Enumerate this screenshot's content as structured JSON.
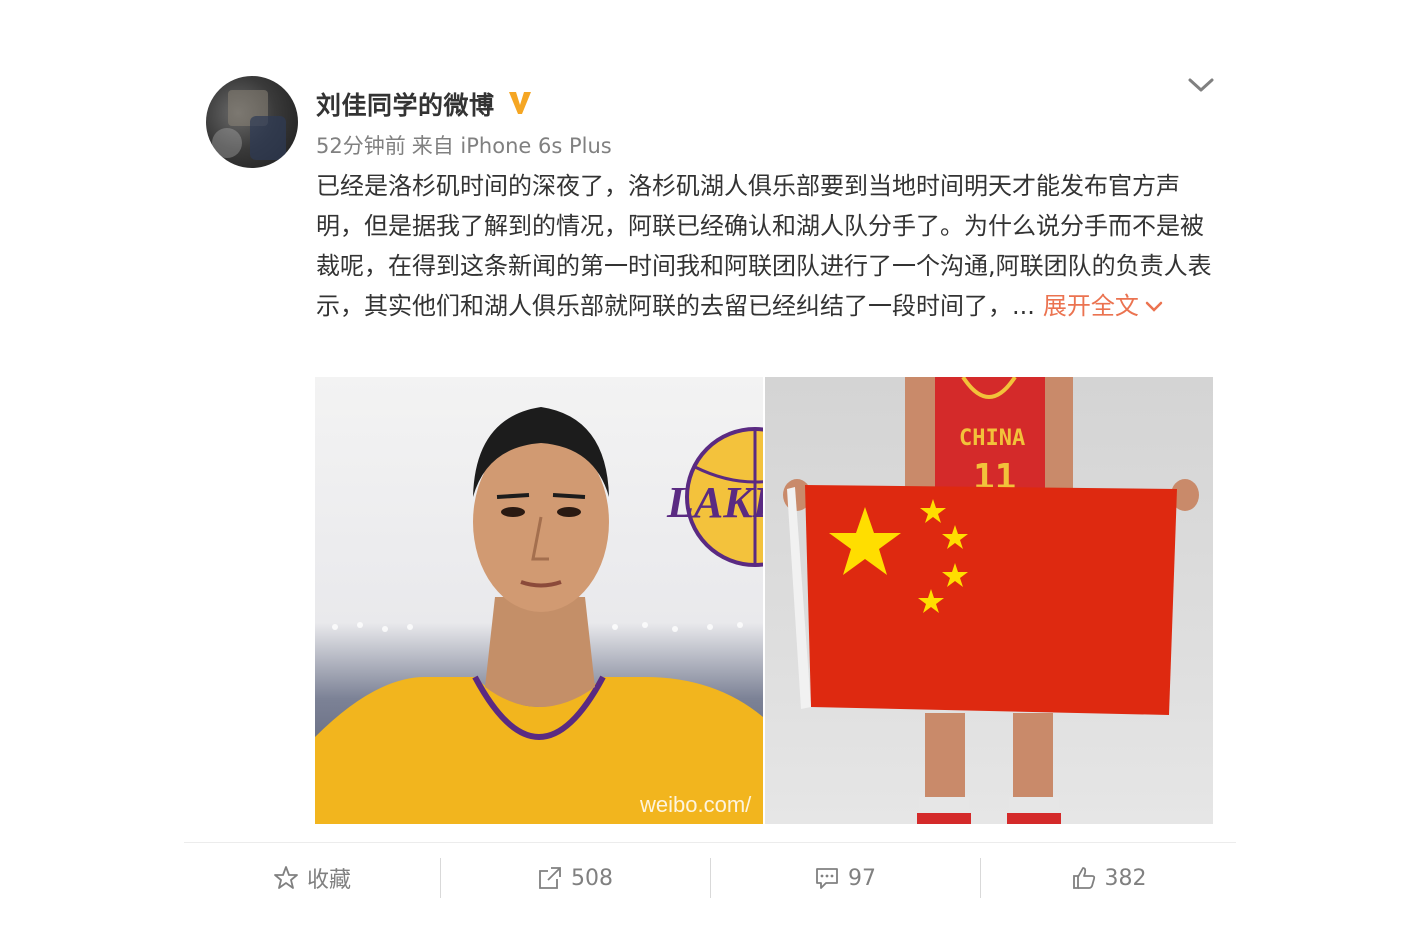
{
  "post": {
    "username": "刘佳同学的微博",
    "time": "52分钟前",
    "source": "来自 iPhone 6s Plus",
    "text": "已经是洛杉矶时间的深夜了，洛杉矶湖人俱乐部要到当地时间明天才能发布官方声明，但是据我了解到的情况，阿联已经确认和湖人队分手了。为什么说分手而不是被裁呢，在得到这条新闻的第一时间我和阿联团队进行了一个沟通,阿联团队的负责人表示，其实他们和湖人俱乐部就阿联的去留已经纠结了一段时间了，...",
    "expand_label": "展开全文"
  },
  "images": {
    "left": {
      "logo_text": "LAKERS",
      "watermark": "weibo.com/"
    },
    "right": {
      "jersey_text": "CHINA",
      "jersey_number": "11"
    }
  },
  "actions": {
    "favorite": {
      "label": "收藏",
      "icon": "star-icon"
    },
    "repost": {
      "count": "508",
      "icon": "share-icon"
    },
    "comment": {
      "count": "97",
      "icon": "comment-icon"
    },
    "like": {
      "count": "382",
      "icon": "thumbs-up-icon"
    }
  },
  "colors": {
    "accent": "#eb7350",
    "verified": "#f5a623",
    "meta_text": "#808080"
  }
}
